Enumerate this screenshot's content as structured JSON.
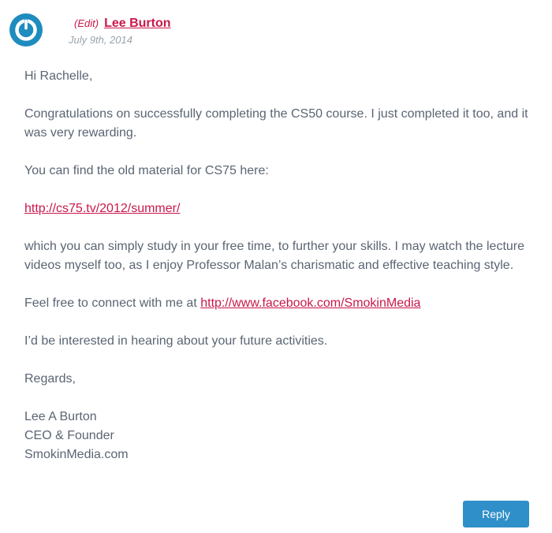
{
  "comment": {
    "edit_label": "(Edit)",
    "author": "Lee Burton",
    "date": "July 9th, 2014",
    "paragraphs": {
      "greeting": "Hi Rachelle,",
      "congrats": "Congratulations on successfully completing the CS50 course. I just completed it too, and it was very rewarding.",
      "material_intro": "You can find the old material for CS75 here:",
      "material_link": "http://cs75.tv/2012/summer/",
      "study_note": "which you can simply study in your free time, to further your skills. I may watch the lecture videos myself too, as I enjoy Professor Malan’s charismatic and effective teaching style.",
      "connect_prefix": "Feel free to connect with me at ",
      "connect_link": "http://www.facebook.com/SmokinMedia",
      "interest": "I’d be interested in hearing about your future activities.",
      "closing": "Regards,"
    },
    "signature": {
      "name": "Lee A Burton",
      "title": "CEO & Founder",
      "company": "SmokinMedia.com"
    },
    "reply_label": "Reply"
  },
  "icons": {
    "avatar": "power-logo-icon"
  },
  "colors": {
    "accent": "#c9184a",
    "avatar_bg": "#1e8cbe",
    "button_bg": "#2f8fc9",
    "text": "#5a6573",
    "muted": "#9aa3ad"
  }
}
